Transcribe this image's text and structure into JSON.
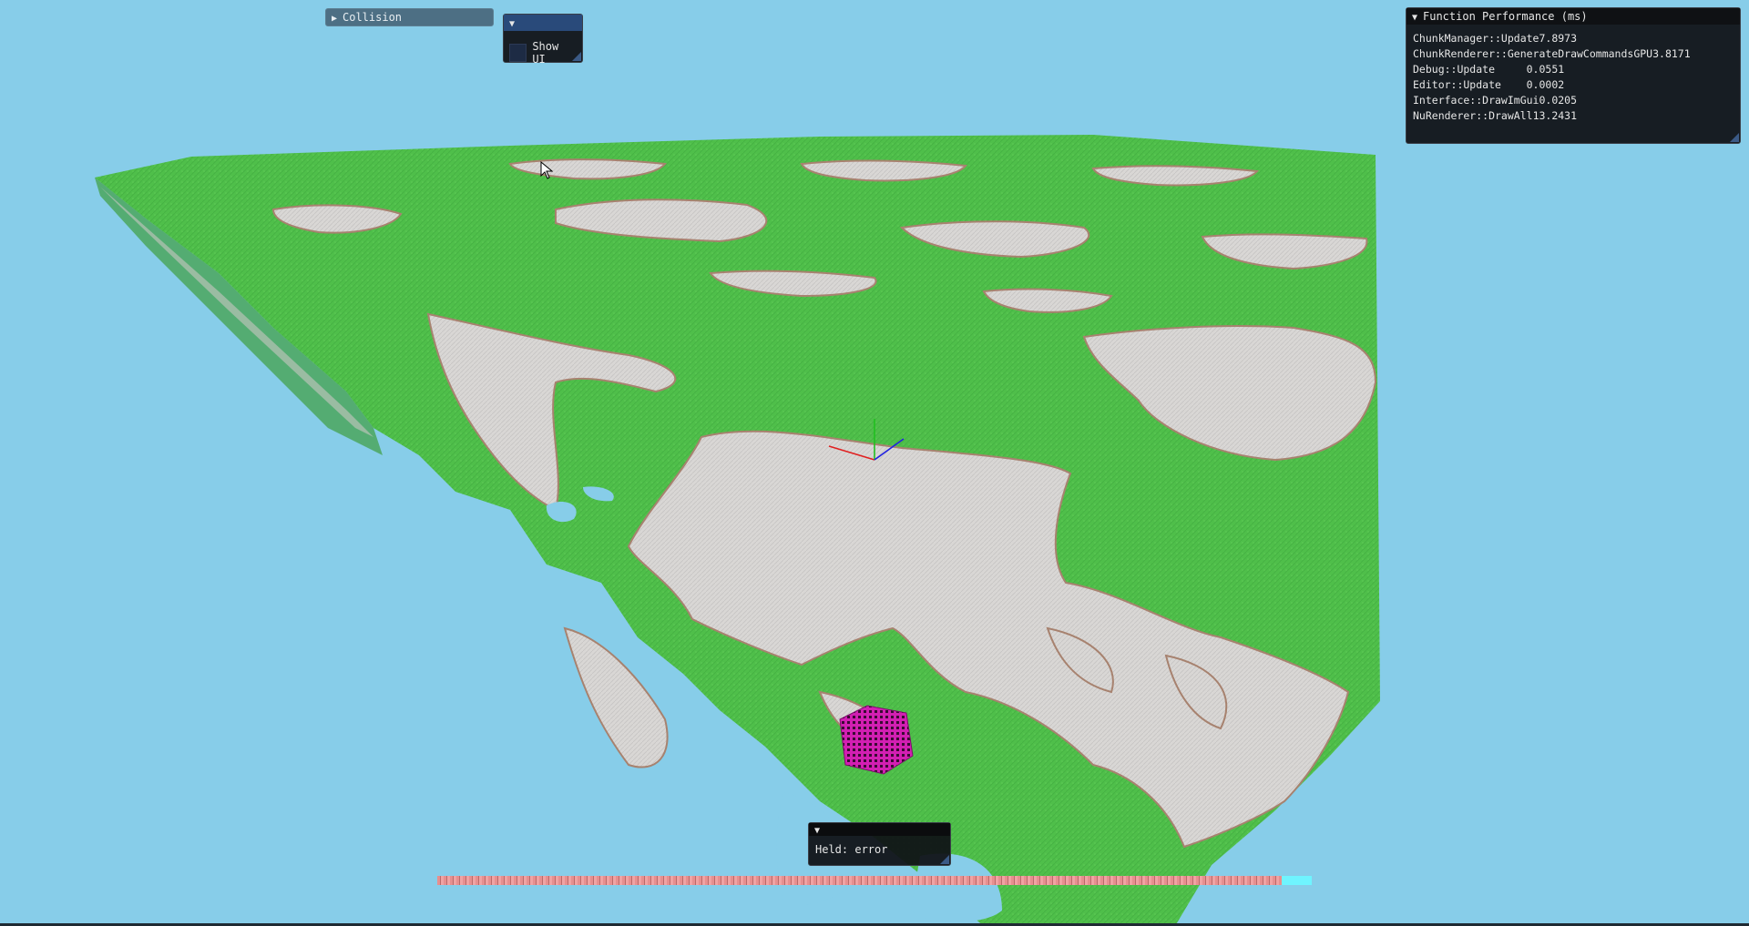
{
  "windows": {
    "collision": {
      "title": "Collision",
      "collapsed": true
    },
    "show_ui": {
      "checkbox_label": "Show UI",
      "checked": false
    },
    "perf": {
      "title": "Function Performance (ms)",
      "rows": [
        {
          "name": "ChunkManager::Update",
          "value": "7.8973"
        },
        {
          "name": "ChunkRenderer::GenerateDrawCommandsGPU",
          "value": "3.8171"
        },
        {
          "name": "Debug::Update     ",
          "value": "0.0551"
        },
        {
          "name": "Editor::Update    ",
          "value": "0.0002"
        },
        {
          "name": "Interface::DrawImGui",
          "value": "0.0205"
        },
        {
          "name": "NuRenderer::DrawAll",
          "value": "13.2431"
        }
      ]
    },
    "held": {
      "text": "Held: error"
    }
  },
  "colors": {
    "sky": "#87cde9",
    "grass": "#4fbf4a",
    "stone": "#d9d6d4",
    "dirt": "#a7826f",
    "cube": "#d21fb2",
    "hotbar": "#e68f8f",
    "hotbar_selected": "#6ff4ff"
  },
  "hotbar": {
    "selected_slot": "last"
  }
}
